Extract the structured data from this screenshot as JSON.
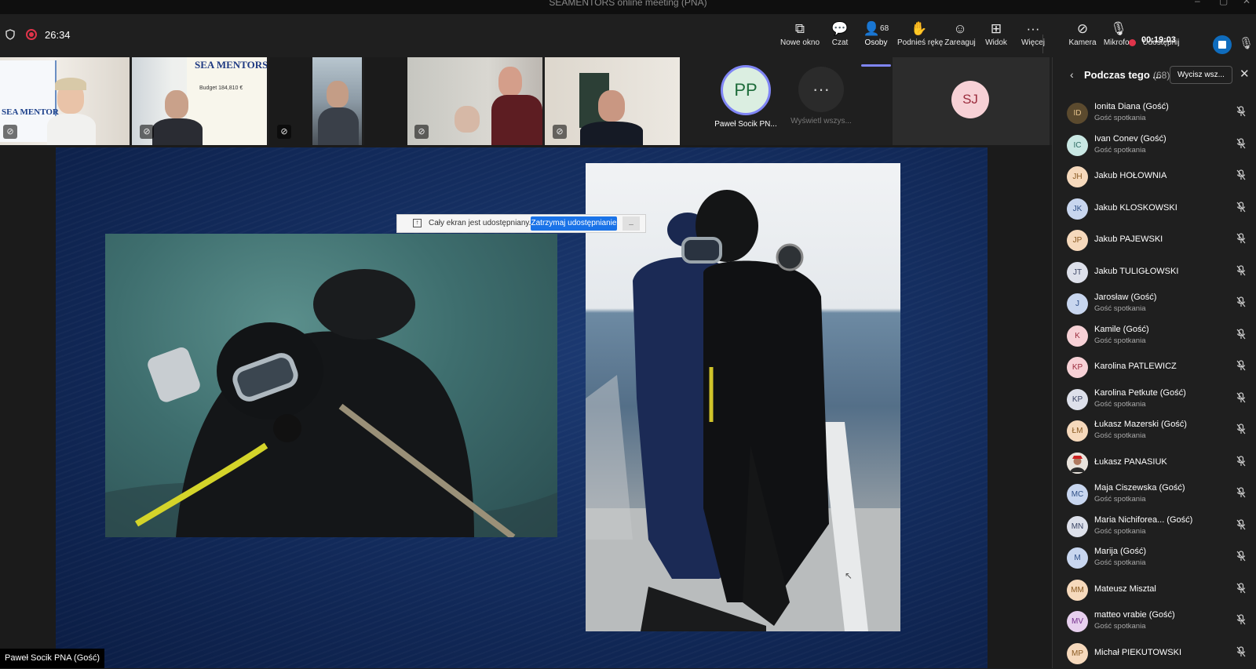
{
  "window": {
    "title": "SEAMENTORS online meeting (PNA)"
  },
  "toolbar": {
    "meeting_timer": "26:34",
    "buttons": {
      "new_window": "Nowe okno",
      "chat": "Czat",
      "people": "Osoby",
      "people_count": "68",
      "raise_hand": "Podnieś rękę",
      "react": "Zareaguj",
      "view": "Widok",
      "more": "Więcej",
      "camera": "Kamera",
      "mic": "Mikrofon",
      "share": "Udostępnij"
    },
    "recording_time": "00:19:03"
  },
  "participants_strip": {
    "avatar_pp": {
      "initials": "PP",
      "name": "Paweł Socik PN..."
    },
    "show_all": "Wyświetl wszys...",
    "avatar_sj": {
      "initials": "SJ"
    },
    "poster_texts": [
      "SEA MENTORS",
      "SEA MENTOR",
      "Budget 184,810 €"
    ]
  },
  "share_bar": {
    "message": "Cały ekran jest udostępniany.",
    "stop_button": "Zatrzymaj udostępnianie"
  },
  "presenter_label": "Paweł Socik PNA (Gość)",
  "people_panel": {
    "title": "Podczas tego ...",
    "count": "(68)",
    "mute_all": "Wycisz wsz...",
    "participants": [
      {
        "initials": "ID",
        "name": "Ionita Diana (Gość)",
        "role": "Gość spotkania",
        "color": "#5b4a2e",
        "fg": "#e6c48e"
      },
      {
        "initials": "IC",
        "name": "Ivan Conev (Gość)",
        "role": "Gość spotkania",
        "color": "#c9e7e3",
        "fg": "#2c6b63"
      },
      {
        "initials": "JH",
        "name": "Jakub HOŁOWNIA",
        "role": "",
        "color": "#f6d9bc",
        "fg": "#8a5a22"
      },
      {
        "initials": "JK",
        "name": "Jakub KLOSKOWSKI",
        "role": "",
        "color": "#c8d6ef",
        "fg": "#2f4f86"
      },
      {
        "initials": "JP",
        "name": "Jakub PAJEWSKI",
        "role": "",
        "color": "#f6d9bc",
        "fg": "#8a5a22"
      },
      {
        "initials": "JT",
        "name": "Jakub TULIGŁOWSKI",
        "role": "",
        "color": "#dde0ea",
        "fg": "#3b4564"
      },
      {
        "initials": "J",
        "name": "Jarosław (Gość)",
        "role": "Gość spotkania",
        "color": "#c8d6ef",
        "fg": "#2f4f86"
      },
      {
        "initials": "K",
        "name": "Kamile (Gość)",
        "role": "Gość spotkania",
        "color": "#f7d1d6",
        "fg": "#9b2c3d"
      },
      {
        "initials": "KP",
        "name": "Karolina PATLEWICZ",
        "role": "",
        "color": "#f7d1d6",
        "fg": "#9b2c3d"
      },
      {
        "initials": "KP",
        "name": "Karolina Petkute (Gość)",
        "role": "Gość spotkania",
        "color": "#dde0ea",
        "fg": "#3b4564"
      },
      {
        "initials": "ŁM",
        "name": "Łukasz Mazerski (Gość)",
        "role": "Gość spotkania",
        "color": "#f6d9bc",
        "fg": "#8a5a22"
      },
      {
        "initials": "",
        "name": "Łukasz PANASIUK",
        "role": "",
        "color": "#e9e3dc",
        "fg": "#444"
      },
      {
        "initials": "MC",
        "name": "Maja Ciszewska (Gość)",
        "role": "Gość spotkania",
        "color": "#c8d6ef",
        "fg": "#2f4f86"
      },
      {
        "initials": "MN",
        "name": "Maria Nichiforea... (Gość)",
        "role": "Gość spotkania",
        "color": "#dde0ea",
        "fg": "#3b4564"
      },
      {
        "initials": "M",
        "name": "Marija (Gość)",
        "role": "Gość spotkania",
        "color": "#c8d6ef",
        "fg": "#2f4f86"
      },
      {
        "initials": "MM",
        "name": "Mateusz Misztal",
        "role": "",
        "color": "#f6d9bc",
        "fg": "#8a5a22"
      },
      {
        "initials": "MV",
        "name": "matteo vrabie (Gość)",
        "role": "Gość spotkania",
        "color": "#e7d0ee",
        "fg": "#74308c"
      },
      {
        "initials": "MP",
        "name": "Michał PIEKUTOWSKI",
        "role": "",
        "color": "#f6d9bc",
        "fg": "#8a5a22"
      }
    ]
  },
  "colors": {
    "accent": "#7f85f5",
    "record_red": "#e0344a",
    "share_blue": "#0f6cbd",
    "slide_bg": "#122a5a"
  },
  "icons": [
    "shield-icon",
    "record-icon",
    "popout-icon",
    "chat-icon",
    "people-icon",
    "hand-icon",
    "emoji-icon",
    "grid-icon",
    "ellipsis-icon",
    "camera-off-icon",
    "mic-icon",
    "stop-icon",
    "mic-off-icon",
    "chevron-left-icon",
    "close-icon"
  ]
}
